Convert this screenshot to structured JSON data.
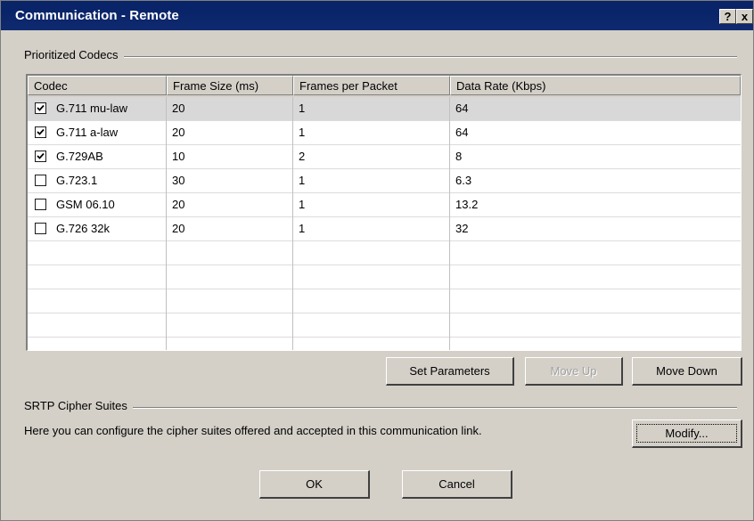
{
  "window": {
    "title": "Communication - Remote",
    "help_button": "?",
    "close_button": "x"
  },
  "codecs_group": {
    "label": "Prioritized Codecs",
    "columns": [
      "Codec",
      "Frame Size (ms)",
      "Frames per Packet",
      "Data Rate (Kbps)"
    ],
    "rows": [
      {
        "checked": true,
        "codec": "G.711 mu-law",
        "frame_size": "20",
        "frames_per_packet": "1",
        "data_rate": "64",
        "selected": true
      },
      {
        "checked": true,
        "codec": "G.711 a-law",
        "frame_size": "20",
        "frames_per_packet": "1",
        "data_rate": "64"
      },
      {
        "checked": true,
        "codec": "G.729AB",
        "frame_size": "10",
        "frames_per_packet": "2",
        "data_rate": "8"
      },
      {
        "checked": false,
        "codec": "G.723.1",
        "frame_size": "30",
        "frames_per_packet": "1",
        "data_rate": "6.3"
      },
      {
        "checked": false,
        "codec": "GSM 06.10",
        "frame_size": "20",
        "frames_per_packet": "1",
        "data_rate": "13.2"
      },
      {
        "checked": false,
        "codec": "G.726 32k",
        "frame_size": "20",
        "frames_per_packet": "1",
        "data_rate": "32"
      }
    ],
    "buttons": {
      "set_parameters": "Set Parameters",
      "move_up": "Move Up",
      "move_down": "Move Down"
    }
  },
  "srtp_group": {
    "label": "SRTP Cipher Suites",
    "description": "Here you can configure the cipher suites offered and accepted in this communication link.",
    "modify_button": "Modify..."
  },
  "footer": {
    "ok": "OK",
    "cancel": "Cancel"
  }
}
